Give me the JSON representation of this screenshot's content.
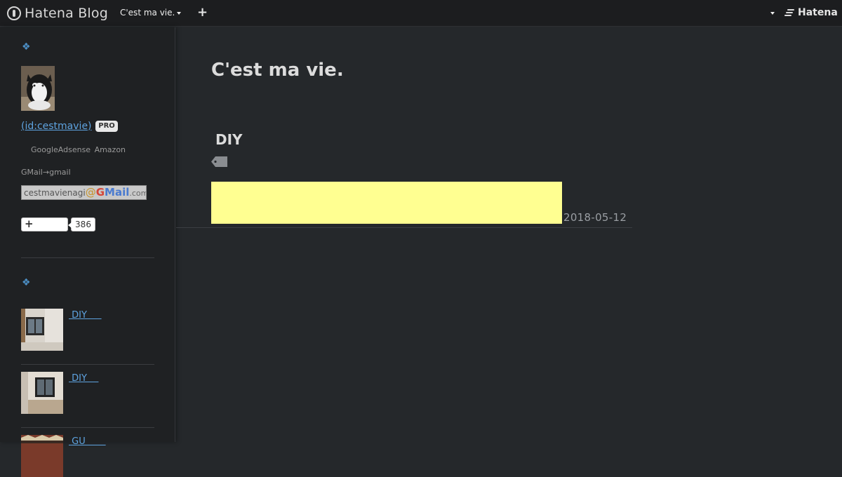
{
  "topbar": {
    "logo_text": "Hatena Blog",
    "blog_name": "C'est ma vie.",
    "plus": "+",
    "brand": "Hatena"
  },
  "sidebar": {
    "section_icon": "❖",
    "profile_link": " (id:cestmavie)",
    "pro_badge": "PRO",
    "ad_line": "GoogleAdsense  Amazon",
    "gmail_line": "GMail→gmail",
    "email": {
      "user": "cestmavienagi",
      "at": "@",
      "brand_g": "G",
      "brand_rest": "Mail",
      "domain": ".com"
    },
    "follow_plus": "+",
    "follow_count": "386",
    "entries": [
      {
        "label": " DIY     ",
        "thumb": "room-window-1"
      },
      {
        "label": " DIY    ",
        "thumb": "room-window-2"
      },
      {
        "label": " GU       ",
        "thumb": "rug-pattern"
      }
    ]
  },
  "main": {
    "blog_title": "C'est ma vie.",
    "category_title": "DIY",
    "entry_date": "2018-05-12"
  },
  "colors": {
    "link": "#5ea3e0",
    "accent_icon": "#4c8fc5",
    "highlight": "#ffff91",
    "background": "#25282b"
  },
  "icons": [
    "hatena-blog-logo-icon",
    "caret-down-icon",
    "plus-icon",
    "hatena-wing-icon",
    "diamond-section-icon",
    "tag-icon"
  ]
}
